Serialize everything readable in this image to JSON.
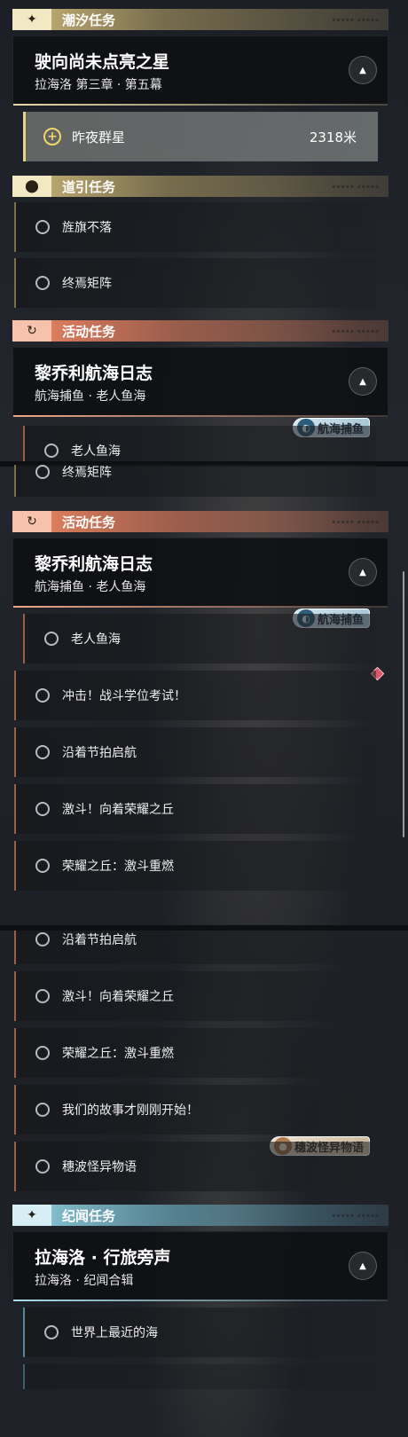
{
  "sections": {
    "tide": {
      "label": "潮汐任务",
      "icon": "sparkle-icon"
    },
    "guide": {
      "label": "道引任务",
      "icon": "location-pin-icon"
    },
    "event": {
      "label": "活动任务",
      "icon": "refresh-arrow-icon"
    },
    "chronicle": {
      "label": "纪闻任务",
      "icon": "sparkle-icon"
    }
  },
  "tide_card": {
    "title": "驶向尚未点亮之星",
    "subtitle": "拉海洛 第三章 · 第五幕"
  },
  "tracked_quest": {
    "name": "昨夜群星",
    "distance": "2318米"
  },
  "guide_items": [
    "旌旗不落",
    "终焉矩阵"
  ],
  "event_card": {
    "title": "黎乔利航海日志",
    "subtitle": "航海捕鱼 · 老人鱼海",
    "tag": "航海捕鱼"
  },
  "partial": {
    "clipped_top": "老人鱼海",
    "clipped_bottom": "终焉矩阵"
  },
  "event_items": [
    "老人鱼海",
    "冲击！战斗学位考试！",
    "沿着节拍启航",
    "激斗！向着荣耀之丘",
    "荣耀之丘：激斗重燃"
  ],
  "event_items_more": [
    "沿着节拍启航",
    "激斗！向着荣耀之丘",
    "荣耀之丘：激斗重燃",
    "我们的故事才刚刚开始！",
    "穗波怪异物语"
  ],
  "mystery_tag": "穗波怪异物语",
  "chronicle_card": {
    "title": "拉海洛 · 行旅旁声",
    "subtitle": "拉海洛 · 纪闻合辑"
  },
  "chronicle_items": [
    "世界上最近的海"
  ],
  "colors": {
    "gold": "#e9d9a3",
    "orange": "#f0a688",
    "blue": "#a9dcea",
    "dark": "#0e1014"
  }
}
